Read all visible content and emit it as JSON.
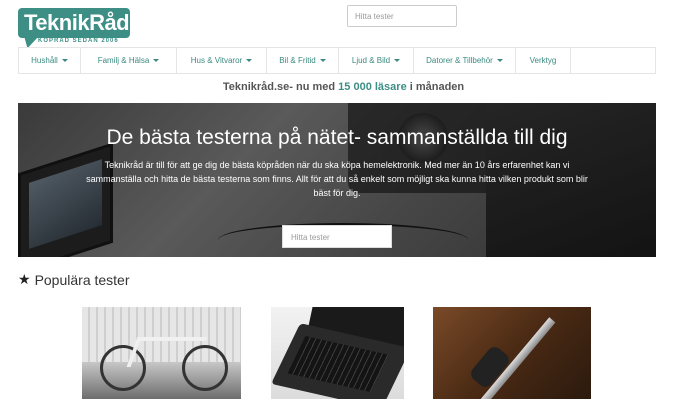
{
  "logo": {
    "text": "TeknikRåd",
    "subtitle": "KÖPRÅD SEDAN 2006"
  },
  "top_search": {
    "placeholder": "Hitta tester"
  },
  "nav": {
    "items": [
      {
        "label": "Hushåll",
        "dropdown": true
      },
      {
        "label": "Familj & Hälsa",
        "dropdown": true
      },
      {
        "label": "Hus & Vitvaror",
        "dropdown": true
      },
      {
        "label": "Bil & Fritid",
        "dropdown": true
      },
      {
        "label": "Ljud & Bild",
        "dropdown": true
      },
      {
        "label": "Datorer & Tillbehör",
        "dropdown": true
      },
      {
        "label": "Verktyg",
        "dropdown": false
      }
    ]
  },
  "tagline": {
    "prefix": "Teknikråd.se- nu med ",
    "highlight": "15 000 läsare",
    "suffix": " i månaden"
  },
  "hero": {
    "title": "De bästa testerna på nätet- sammanställda till dig",
    "text": "Teknikråd är till för att ge dig de bästa köpråden när du ska köpa hemelektronik. Med mer än 10 års erfarenhet kan vi sammanställa och hitta de bästa testerna som finns. Allt för att du så enkelt som möjligt ska kunna hitta vilken produkt som blir bäst för dig.",
    "search_placeholder": "Hitta tester"
  },
  "popular": {
    "title": "Populära tester",
    "icon": "star-icon"
  },
  "colors": {
    "brand": "#3d8f86",
    "nav_text": "#3a8a80"
  }
}
